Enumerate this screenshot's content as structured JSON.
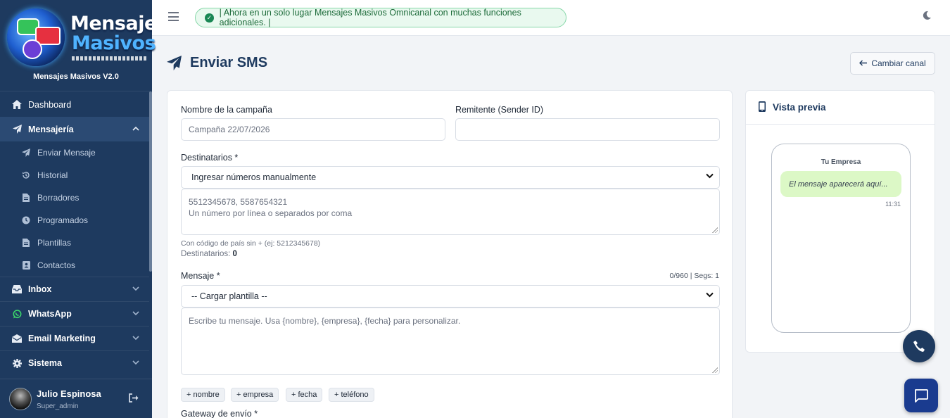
{
  "brand": {
    "logo_line1": "Mensajes",
    "logo_line2": "Masivos",
    "version": "Mensajes Masivos V2.0"
  },
  "sidebar": {
    "dashboard": "Dashboard",
    "mensajeria": "Mensajería",
    "sub_items": [
      {
        "label": "Enviar Mensaje",
        "icon": "paper-plane-icon"
      },
      {
        "label": "Historial",
        "icon": "history-icon"
      },
      {
        "label": "Borradores",
        "icon": "file-icon"
      },
      {
        "label": "Programados",
        "icon": "clock-icon"
      },
      {
        "label": "Plantillas",
        "icon": "file-icon"
      },
      {
        "label": "Contactos",
        "icon": "address-book-icon"
      }
    ],
    "inbox": "Inbox",
    "whatsapp": "WhatsApp",
    "email_marketing": "Email Marketing",
    "sistema": "Sistema"
  },
  "user": {
    "name": "Julio Espinosa",
    "role": "Super_admin"
  },
  "header": {
    "banner": "| Ahora en un solo lugar Mensajes Masivos Omnicanal con muchas funciones adicionales. |"
  },
  "page": {
    "title": "Enviar SMS",
    "change_channel": "Cambiar canal"
  },
  "form": {
    "campaign_label": "Nombre de la campaña",
    "campaign_placeholder": "Campaña 22/07/2026",
    "sender_label": "Remitente (Sender ID)",
    "sender_value": "",
    "recipients_label": "Destinatarios *",
    "recipients_select": "Ingresar números manualmente",
    "recipients_placeholder_line1": "5512345678, 5587654321",
    "recipients_placeholder_line2": "Un número por línea o separados por coma",
    "country_hint": "Con código de país sin + (ej: 5212345678)",
    "recipients_count_label": "Destinatarios:",
    "recipients_count": "0",
    "message_label": "Mensaje *",
    "message_counter": "0/960 | Segs: 1",
    "template_select": "-- Cargar plantilla --",
    "message_placeholder": "Escribe tu mensaje. Usa {nombre}, {empresa}, {fecha} para personalizar.",
    "chips": [
      "+ nombre",
      "+ empresa",
      "+ fecha",
      "+ teléfono"
    ],
    "gateway_label": "Gateway de envío *"
  },
  "preview": {
    "title": "Vista previa",
    "company": "Tu Empresa",
    "message": "El mensaje aparecerá aquí...",
    "time": "11:31"
  },
  "colors": {
    "sidebar_bg": "#1e3a5f",
    "accent": "#1e3a5f",
    "banner_bg": "#e9f9ef",
    "bubble_bg": "#dcf8c6"
  }
}
